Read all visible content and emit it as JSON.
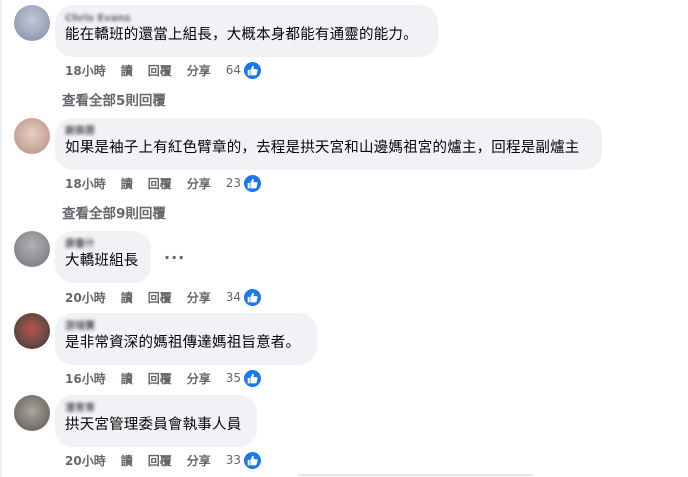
{
  "comments": [
    {
      "author": "Chris Evans",
      "text": "能在轎班的還當上組長，大概本身都能有通靈的能力。",
      "time": "18小時",
      "read": "讀",
      "reply": "回覆",
      "share": "分享",
      "likes": "64",
      "view_replies": "查看全部5則回覆",
      "avatar_color": "#9aa3b8"
    },
    {
      "author": "謝佩蓉",
      "text": "如果是袖子上有紅色臂章的，去程是拱天宮和山邊媽祖宮的爐主，回程是副爐主",
      "time": "18小時",
      "read": "讀",
      "reply": "回覆",
      "share": "分享",
      "likes": "23",
      "view_replies": "查看全部9則回覆",
      "avatar_color": "#c9a79a"
    },
    {
      "author": "康書什",
      "text": "大轎班組長",
      "time": "20小時",
      "read": "讀",
      "reply": "回覆",
      "share": "分享",
      "likes": "34",
      "more": "···",
      "avatar_color": "#8b8c92"
    },
    {
      "author": "游瑞寶",
      "text": "是非常資深的媽祖傳達媽祖旨意者。",
      "time": "16小時",
      "read": "讀",
      "reply": "回覆",
      "share": "分享",
      "likes": "35",
      "avatar_color": "#6b4b45"
    },
    {
      "author": "潘育青",
      "text": "拱天宮管理委員會執事人員",
      "time": "20小時",
      "read": "讀",
      "reply": "回覆",
      "share": "分享",
      "likes": "33",
      "avatar_color": "#7d7a74"
    }
  ],
  "colors": {
    "like_blue": "#1877f2",
    "bubble_bg": "#f0f2f5",
    "meta_gray": "#65676b"
  }
}
